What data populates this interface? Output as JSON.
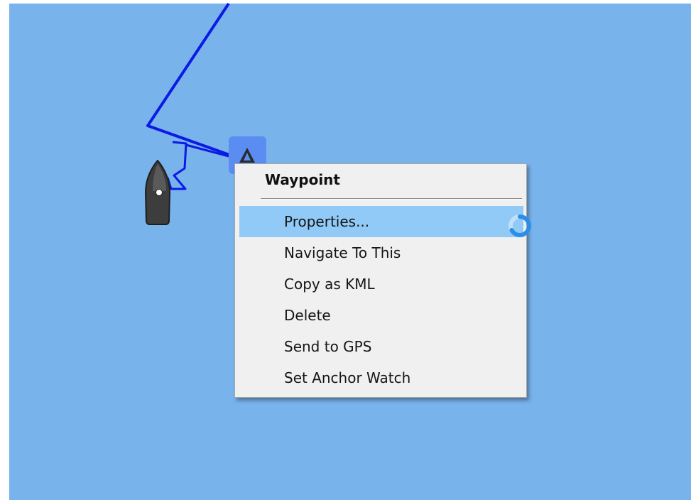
{
  "map": {
    "background_color": "#78b3ec",
    "track_color": "#0b1be3",
    "boat_icon": "boat-icon",
    "waypoint_icon": "waypoint-triangle-icon",
    "waypoint_highlight_color": "#5a8cf1"
  },
  "context_menu": {
    "title": "Waypoint",
    "items": [
      {
        "label": "Properties...",
        "highlighted": true
      },
      {
        "label": "Navigate To This",
        "highlighted": false
      },
      {
        "label": "Copy as KML",
        "highlighted": false
      },
      {
        "label": "Delete",
        "highlighted": false
      },
      {
        "label": "Send to GPS",
        "highlighted": false
      },
      {
        "label": "Set Anchor Watch",
        "highlighted": false
      }
    ],
    "highlight_color": "#91c9f7"
  },
  "cursor": {
    "icon": "busy-spinner-icon",
    "color": "#2b8fe8"
  }
}
